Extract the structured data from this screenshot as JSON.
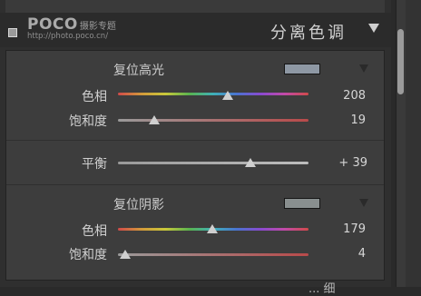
{
  "header": {
    "watermark_logo": "POCO",
    "watermark_cn": "摄影专题",
    "watermark_url": "http://photo.poco.cn/",
    "title": "分离色调"
  },
  "highlights": {
    "label": "复位高光",
    "swatch_color": "#8e98a4",
    "hue": {
      "label": "色相",
      "value": "208",
      "fraction": 0.578
    },
    "saturation": {
      "label": "饱和度",
      "value": "19",
      "fraction": 0.19
    }
  },
  "balance": {
    "label": "平衡",
    "value": "+ 39",
    "fraction": 0.695
  },
  "shadows": {
    "label": "复位阴影",
    "swatch_color": "#898f8f",
    "hue": {
      "label": "色相",
      "value": "179",
      "fraction": 0.497
    },
    "saturation": {
      "label": "饱和度",
      "value": "4",
      "fraction": 0.04
    }
  },
  "colors": {
    "hue_gradient": "linear-gradient(to right,#d04a4a,#d39a3a,#c9c83a,#59b34f,#3fb0b8,#4a73d0,#8a4ad0,#c24aa8,#d04a4a)",
    "sat_gradient": "linear-gradient(to right,#9a9a9a,#b84a4a)",
    "balance_gradient": "linear-gradient(to right,#9a9a9a,#bdbdbd)"
  },
  "bottom_peek": "... 细"
}
